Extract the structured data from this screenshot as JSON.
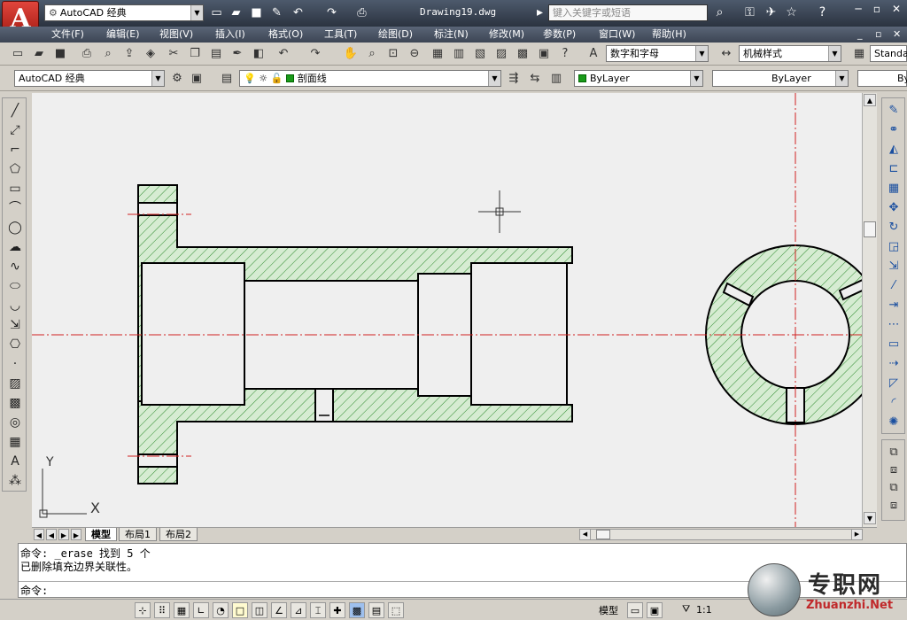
{
  "titlebar": {
    "app_button": "A",
    "workspace": "AutoCAD 经典",
    "document_title": "Drawing19.dwg",
    "search_placeholder": "键入关键字或短语"
  },
  "menu": [
    "文件(F)",
    "编辑(E)",
    "视图(V)",
    "插入(I)",
    "格式(O)",
    "工具(T)",
    "绘图(D)",
    "标注(N)",
    "修改(M)",
    "参数(P)",
    "窗口(W)",
    "帮助(H)"
  ],
  "toolbar2": {
    "text_style": "数字和字母",
    "dim_style": "机械样式",
    "table_style": "Standa"
  },
  "toolbar3": {
    "workspace": "AutoCAD 经典",
    "layer": "剖面线",
    "color": "ByLayer",
    "linetype": "ByLayer",
    "lineweight": "By"
  },
  "canvas": {
    "ucs_y": "Y",
    "ucs_x": "X"
  },
  "tabs": [
    "模型",
    "布局1",
    "布局2"
  ],
  "command": {
    "line1": "命令:  _erase 找到 5 个",
    "line2": "已删除填充边界关联性。",
    "prompt": "命令:"
  },
  "status": {
    "model": "模型",
    "scale": "1:1"
  },
  "logo": {
    "cn": "专职网",
    "en": "Zhuanzhi.Net"
  },
  "colors": {
    "hatch_fill": "#d6ecd2",
    "hatch_line": "#2e8b2e",
    "center_line": "#d02020"
  }
}
